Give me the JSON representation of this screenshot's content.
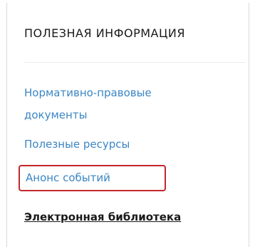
{
  "useful_info": {
    "title": "ПОЛЕЗНАЯ ИНФОРМАЦИЯ",
    "links": [
      {
        "label": "Нормативно-правовые документы"
      },
      {
        "label": "Полезные ресурсы"
      },
      {
        "label": "Анонс событий",
        "highlighted": true,
        "highlight_color": "#c3272b"
      }
    ],
    "library_link": "Электронная библиотека",
    "link_color": "#3b86c4"
  }
}
